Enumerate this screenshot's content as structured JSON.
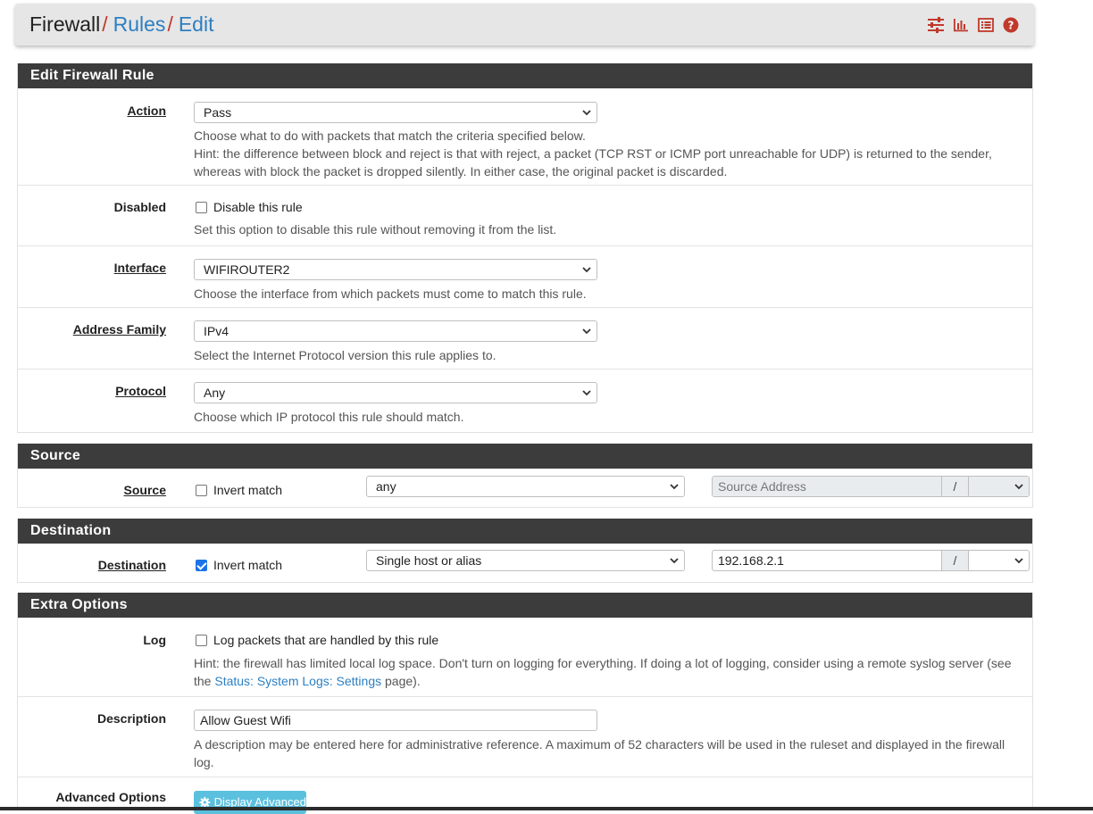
{
  "breadcrumb": {
    "root": "Firewall",
    "link1": "Rules",
    "link2": "Edit",
    "separator": "/"
  },
  "toolbar": {
    "icons": [
      "sliders-icon",
      "bar-chart-icon",
      "list-icon",
      "help-icon"
    ],
    "color": "#c0392b"
  },
  "edit_panel": {
    "title": "Edit Firewall Rule",
    "action": {
      "label": "Action",
      "value": "Pass",
      "help1": "Choose what to do with packets that match the criteria specified below.",
      "help2": "Hint: the difference between block and reject is that with reject, a packet (TCP RST or ICMP port unreachable for UDP) is returned to the sender, whereas with block the packet is dropped silently. In either case, the original packet is discarded."
    },
    "disabled": {
      "label": "Disabled",
      "checkbox_label": "Disable this rule",
      "checked": false,
      "help": "Set this option to disable this rule without removing it from the list."
    },
    "interface": {
      "label": "Interface",
      "value": "WIFIROUTER2",
      "help": "Choose the interface from which packets must come to match this rule."
    },
    "address_family": {
      "label": "Address Family",
      "value": "IPv4",
      "help": "Select the Internet Protocol version this rule applies to."
    },
    "protocol": {
      "label": "Protocol",
      "value": "Any",
      "help": "Choose which IP protocol this rule should match."
    }
  },
  "source_panel": {
    "title": "Source",
    "label": "Source",
    "invert_label": "Invert match",
    "invert_checked": false,
    "type_value": "any",
    "address_placeholder": "Source Address",
    "mask_separator": "/"
  },
  "destination_panel": {
    "title": "Destination",
    "label": "Destination",
    "invert_label": "Invert match",
    "invert_checked": true,
    "type_value": "Single host or alias",
    "address_value": "192.168.2.1",
    "mask_separator": "/"
  },
  "extra_panel": {
    "title": "Extra Options",
    "log": {
      "label": "Log",
      "checkbox_label": "Log packets that are handled by this rule",
      "checked": false,
      "help_prefix": "Hint: the firewall has limited local log space. Don't turn on logging for everything. If doing a lot of logging, consider using a remote syslog server (see the",
      "help_link": "Status: System Logs: Settings",
      "help_suffix": "page)."
    },
    "description": {
      "label": "Description",
      "value": "Allow Guest Wifi",
      "help": "A description may be entered here for administrative reference. A maximum of 52 characters will be used in the ruleset and displayed in the firewall log."
    },
    "advanced": {
      "label": "Advanced Options",
      "button_label": "Display Advanced"
    }
  },
  "colors": {
    "header": "#3c3c3c",
    "link": "#2d7fc1",
    "button": "#5bc0de",
    "checkbox": "#1a73e8"
  }
}
